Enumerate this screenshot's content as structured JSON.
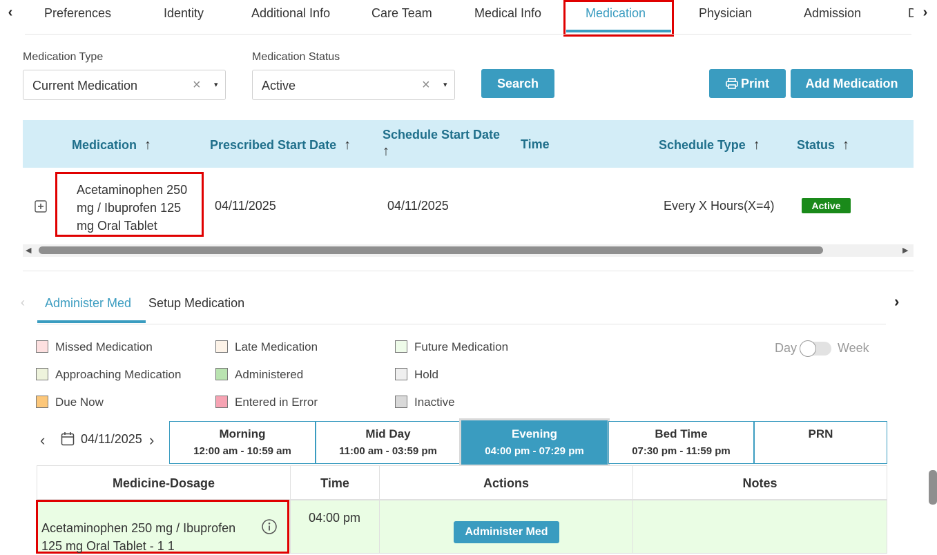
{
  "nav": {
    "tabs": [
      "Preferences",
      "Identity",
      "Additional Info",
      "Care Team",
      "Medical Info",
      "Medication",
      "Physician",
      "Admission",
      "D"
    ],
    "active": "Medication"
  },
  "filters": {
    "medication_type_label": "Medication Type",
    "medication_type_value": "Current Medication",
    "medication_status_label": "Medication Status",
    "medication_status_value": "Active",
    "clear_glyph": "×",
    "caret_glyph": "▾",
    "search_label": "Search",
    "print_label": "Print",
    "add_label": "Add Medication"
  },
  "table": {
    "headers": [
      "Medication",
      "Prescribed Start Date",
      "Schedule Start Date",
      "Time",
      "Schedule Type",
      "Status"
    ],
    "sort_glyph": "↑",
    "row": {
      "medication": [
        "Acetaminophen 250",
        "mg / Ibuprofen 125",
        "mg Oral Tablet"
      ],
      "prescribed_start": "04/11/2025",
      "schedule_start": "04/11/2025",
      "time": "",
      "schedule_type": "Every X Hours(X=4)",
      "status": "Active"
    }
  },
  "subtabs": {
    "items": [
      "Administer Med",
      "Setup Medication"
    ],
    "active": "Administer Med"
  },
  "legend": [
    {
      "label": "Missed Medication",
      "color": "#fde0e0"
    },
    {
      "label": "Late Medication",
      "color": "#fdf3e8"
    },
    {
      "label": "Future Medication",
      "color": "#eefbe9"
    },
    {
      "label": "Approaching Medication",
      "color": "#eef3dc"
    },
    {
      "label": "Administered",
      "color": "#b9e3b0"
    },
    {
      "label": "Hold",
      "color": "#efefef"
    },
    {
      "label": "Due Now",
      "color": "#fcc77a"
    },
    {
      "label": "Entered in Error",
      "color": "#f6a3b3"
    },
    {
      "label": "Inactive",
      "color": "#d9d9d9"
    }
  ],
  "view_toggle": {
    "left": "Day",
    "right": "Week"
  },
  "schedule": {
    "date": "04/11/2025",
    "slots": [
      {
        "name": "Morning",
        "range": "12:00 am - 10:59 am"
      },
      {
        "name": "Mid Day",
        "range": "11:00 am - 03:59 pm"
      },
      {
        "name": "Evening",
        "range": "04:00 pm - 07:29 pm"
      },
      {
        "name": "Bed Time",
        "range": "07:30 pm - 11:59 pm"
      },
      {
        "name": "PRN",
        "range": ""
      }
    ],
    "active_slot": "Evening",
    "grid_headers": [
      "Medicine-Dosage",
      "Time",
      "Actions",
      "Notes"
    ],
    "row": {
      "medicine": [
        "Acetaminophen 250 mg / Ibuprofen",
        "125 mg Oral Tablet - 1 1"
      ],
      "time": "04:00 pm",
      "action": "Administer Med",
      "notes": ""
    }
  }
}
